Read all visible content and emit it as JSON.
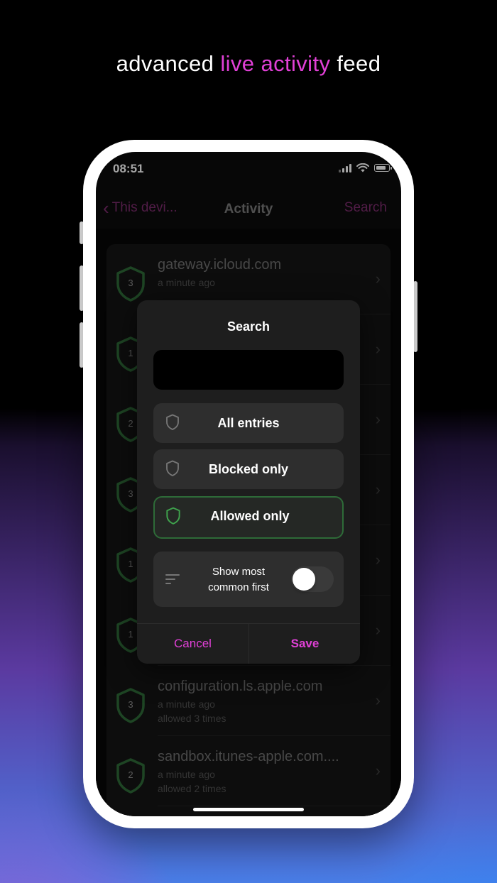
{
  "headline": {
    "prefix": "advanced ",
    "accent": "live activity",
    "suffix": " feed"
  },
  "status": {
    "time": "08:51"
  },
  "nav": {
    "back_label": "This devi...",
    "title": "Activity",
    "search_label": "Search"
  },
  "rows": [
    {
      "domain": "gateway.icloud.com",
      "time": "a minute ago",
      "count": "",
      "badge": "3"
    },
    {
      "domain": "",
      "time": "",
      "count": "",
      "badge": "1"
    },
    {
      "domain": "",
      "time": "",
      "count": "",
      "badge": "2"
    },
    {
      "domain": "",
      "time": "",
      "count": "",
      "badge": "3"
    },
    {
      "domain": "",
      "time": "",
      "count": "",
      "badge": "1"
    },
    {
      "domain": "",
      "time": "",
      "count": "",
      "badge": "1"
    },
    {
      "domain": "configuration.ls.apple.com",
      "time": "a minute ago",
      "count": "allowed 3 times",
      "badge": "3"
    },
    {
      "domain": "sandbox.itunes-apple.com....",
      "time": "a minute ago",
      "count": "allowed 2 times",
      "badge": "2"
    }
  ],
  "modal": {
    "title": "Search",
    "input_value": "",
    "options": [
      {
        "label": "All entries",
        "selected": false
      },
      {
        "label": "Blocked only",
        "selected": false
      },
      {
        "label": "Allowed only",
        "selected": true
      }
    ],
    "toggle_label_line1": "Show most",
    "toggle_label_line2": "common first",
    "toggle_on": false,
    "cancel_label": "Cancel",
    "save_label": "Save"
  },
  "colors": {
    "accent": "#e040d6",
    "shield_green": "#2e6b38",
    "selected_icon": "#3fa34d"
  },
  "icons": {
    "back": "chevron-left-icon",
    "shield": "shield-icon",
    "sort": "sort-lines-icon"
  }
}
